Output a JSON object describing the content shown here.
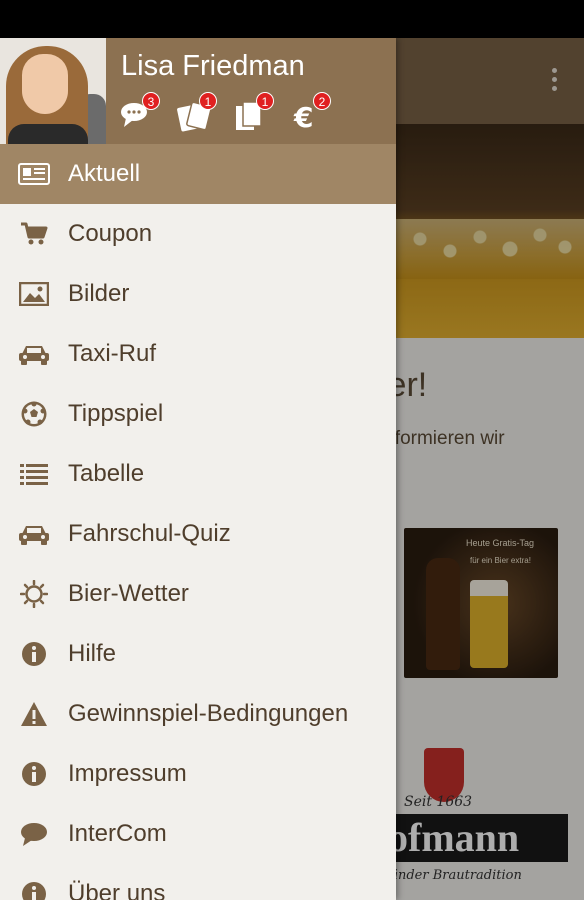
{
  "user": {
    "name": "Lisa Friedman",
    "badges": [
      {
        "icon": "chat-bubbles-icon",
        "count": "3"
      },
      {
        "icon": "tickets-icon",
        "count": "1"
      },
      {
        "icon": "documents-icon",
        "count": "1"
      },
      {
        "icon": "euro-icon",
        "count": "2"
      }
    ]
  },
  "menu": [
    {
      "label": "Aktuell",
      "icon": "newspaper-icon",
      "active": true
    },
    {
      "label": "Coupon",
      "icon": "shopping-cart-icon"
    },
    {
      "label": "Bilder",
      "icon": "picture-icon"
    },
    {
      "label": "Taxi-Ruf",
      "icon": "car-icon"
    },
    {
      "label": "Tippspiel",
      "icon": "soccer-ball-icon"
    },
    {
      "label": "Tabelle",
      "icon": "list-icon"
    },
    {
      "label": "Fahrschul-Quiz",
      "icon": "car-icon"
    },
    {
      "label": "Bier-Wetter",
      "icon": "sun-icon"
    },
    {
      "label": "Hilfe",
      "icon": "info-icon"
    },
    {
      "label": "Gewinnspiel-Bedingungen",
      "icon": "warning-icon"
    },
    {
      "label": "Impressum",
      "icon": "info-icon"
    },
    {
      "label": "InterCom",
      "icon": "chat-bubble-icon"
    },
    {
      "label": "Über uns",
      "icon": "info-icon"
    }
  ],
  "background": {
    "headline": "ier!",
    "subline": "informieren wir",
    "promo_line1": "Heute Gratis-Tag",
    "promo_line2": "für ein Bier extra!",
    "logo_year": "Seit 1663",
    "logo_word": "ofmann",
    "logo_motto": "ränder Brautradition"
  },
  "colors": {
    "header": "#8c7151",
    "active_item": "#a08665",
    "text": "#4f3e2c",
    "drawer_bg": "#f2f0ec",
    "badge": "#e02020"
  }
}
